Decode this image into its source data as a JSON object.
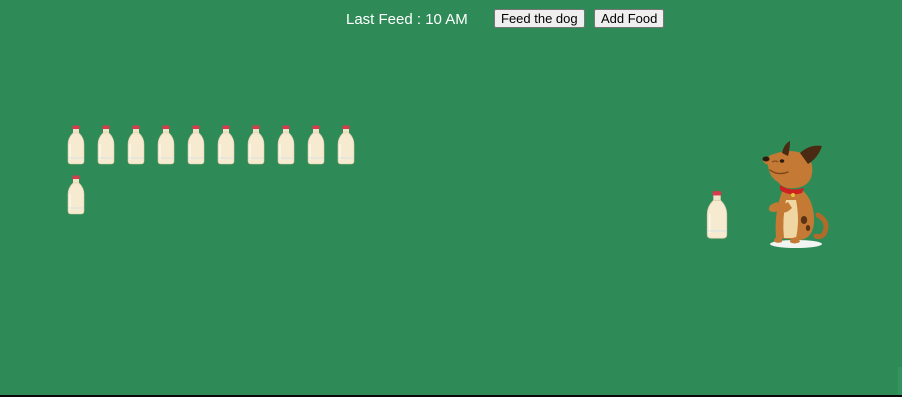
{
  "header": {
    "last_feed_text": "Last Feed : 10 AM",
    "feed_button_label": "Feed the dog",
    "add_button_label": "Add Food"
  },
  "game": {
    "milk_bottle_count": 11,
    "bottle_near_dog": true,
    "background_color": "#2e8b57"
  },
  "icons": {
    "bottle": "milk-bottle-icon",
    "dog": "dog-icon"
  }
}
